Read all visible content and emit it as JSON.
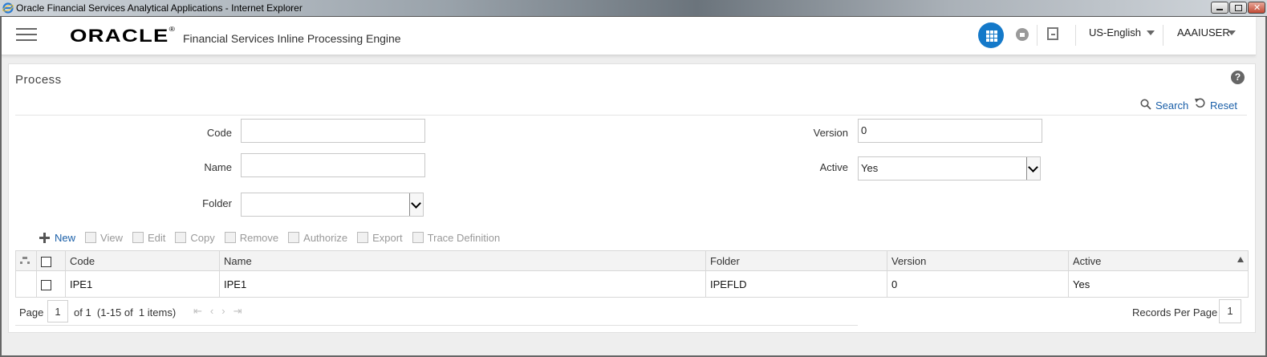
{
  "window": {
    "title": "Oracle Financial Services Analytical Applications - Internet Explorer"
  },
  "header": {
    "logo": "ORACLE",
    "app_name": "Financial Services Inline Processing Engine",
    "language": "US-English",
    "user": "AAAIUSER"
  },
  "page": {
    "title": "Process",
    "help": "?",
    "search_label": "Search",
    "reset_label": "Reset"
  },
  "form": {
    "code": {
      "label": "Code",
      "value": ""
    },
    "name": {
      "label": "Name",
      "value": ""
    },
    "folder": {
      "label": "Folder",
      "value": ""
    },
    "version": {
      "label": "Version",
      "value": "0"
    },
    "active": {
      "label": "Active",
      "value": "Yes"
    }
  },
  "toolbar": {
    "new": "New",
    "view": "View",
    "edit": "Edit",
    "copy": "Copy",
    "remove": "Remove",
    "authorize": "Authorize",
    "export": "Export",
    "trace": "Trace Definition"
  },
  "table": {
    "columns": [
      "Code",
      "Name",
      "Folder",
      "Version",
      "Active"
    ],
    "rows": [
      {
        "code": "IPE1",
        "name": "IPE1",
        "folder": "IPEFLD",
        "version": "0",
        "active": "Yes"
      }
    ]
  },
  "pager": {
    "page_label": "Page",
    "page": "1",
    "of_text": "of 1  (1-15 of  1 items)",
    "records_label": "Records Per Page",
    "records_per_page": "1"
  },
  "colors": {
    "accent": "#1479c9",
    "link": "#1a5fa8"
  }
}
